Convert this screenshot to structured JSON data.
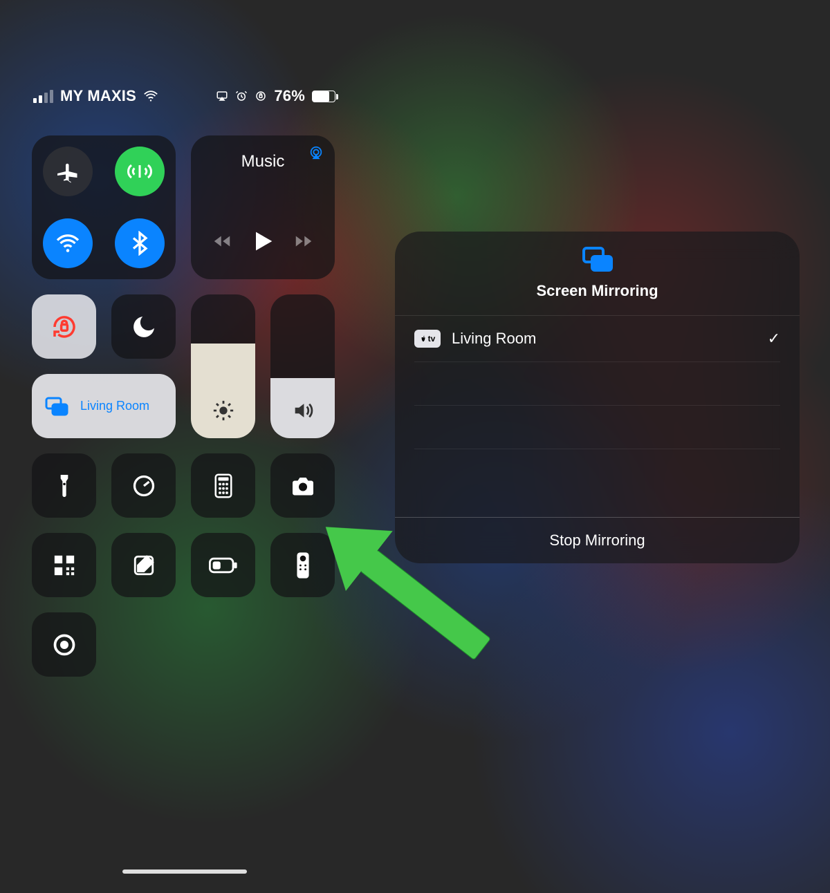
{
  "status": {
    "carrier": "MY MAXIS",
    "battery_pct": "76%"
  },
  "cc": {
    "music_label": "Music",
    "mirror_destination": "Living Room"
  },
  "sheet": {
    "title": "Screen Mirroring",
    "device": "Living Room",
    "tv_badge": "tv",
    "stop_label": "Stop Mirroring"
  }
}
